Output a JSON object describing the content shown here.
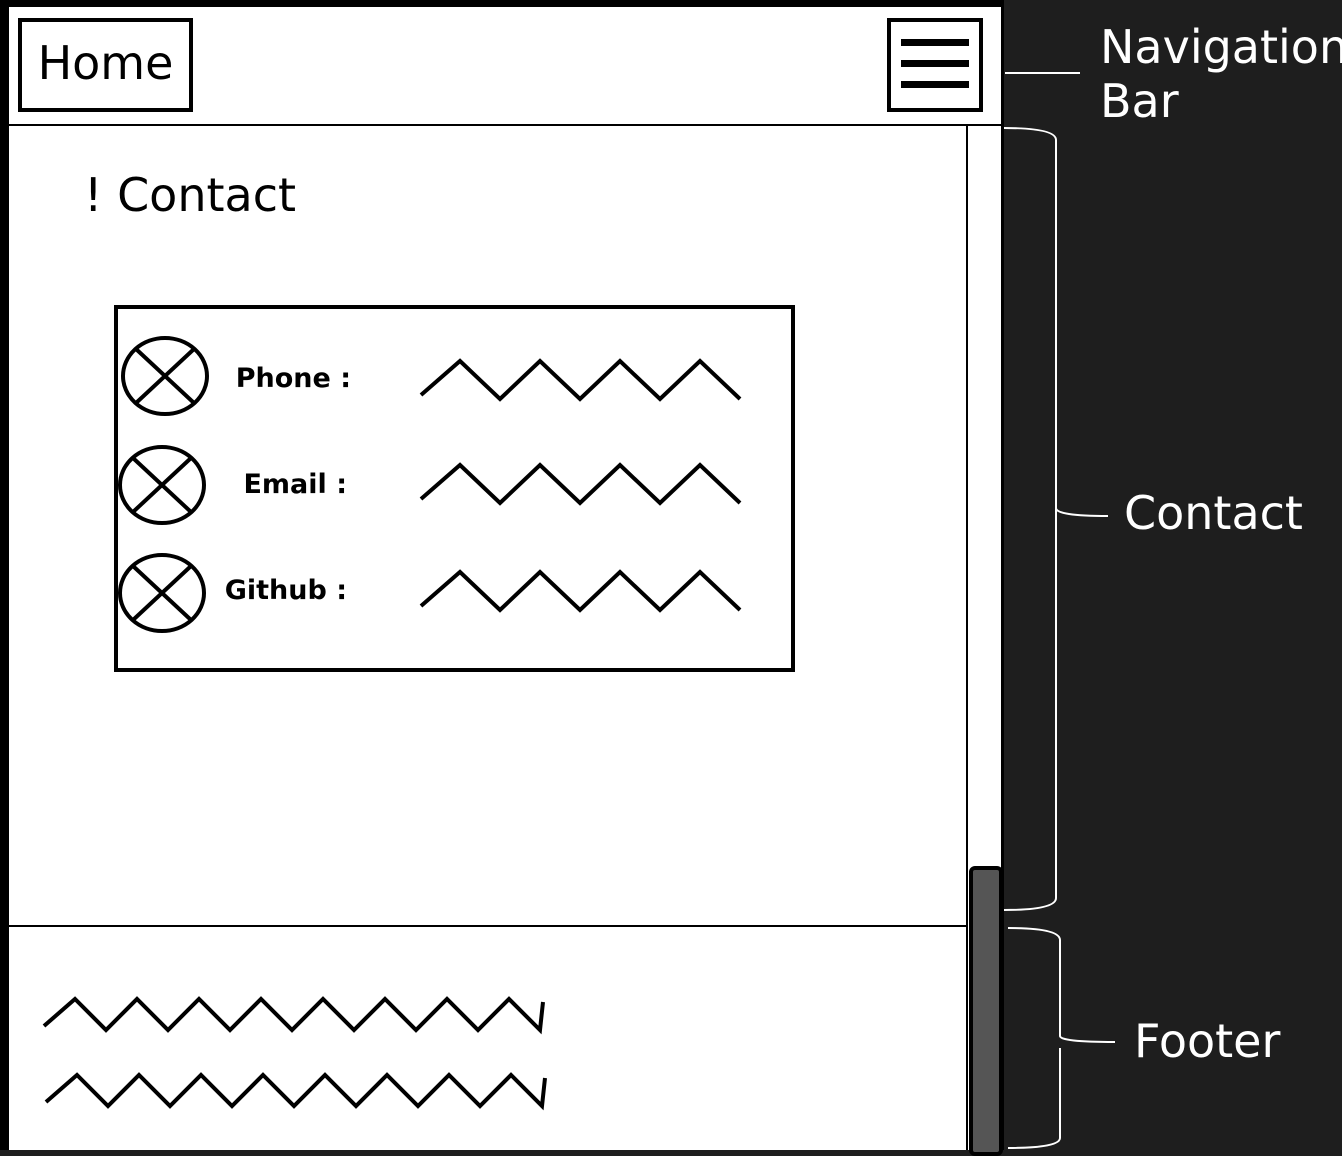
{
  "nav": {
    "home_label": "Home",
    "menu_icon": "hamburger-menu-icon"
  },
  "contact": {
    "title": "! Contact",
    "items": [
      {
        "label": "Phone :",
        "icon": "placeholder-x-icon"
      },
      {
        "label": "Email :",
        "icon": "placeholder-x-icon"
      },
      {
        "label": "Github :",
        "icon": "placeholder-x-icon"
      }
    ]
  },
  "annotations": {
    "navigation": [
      "Navigation",
      "Bar"
    ],
    "contact": "Contact",
    "footer": "Footer"
  },
  "colors": {
    "background": "#1e1e1e",
    "canvas": "#ffffff",
    "ink": "#000000",
    "scroll_thumb": "#555555"
  }
}
